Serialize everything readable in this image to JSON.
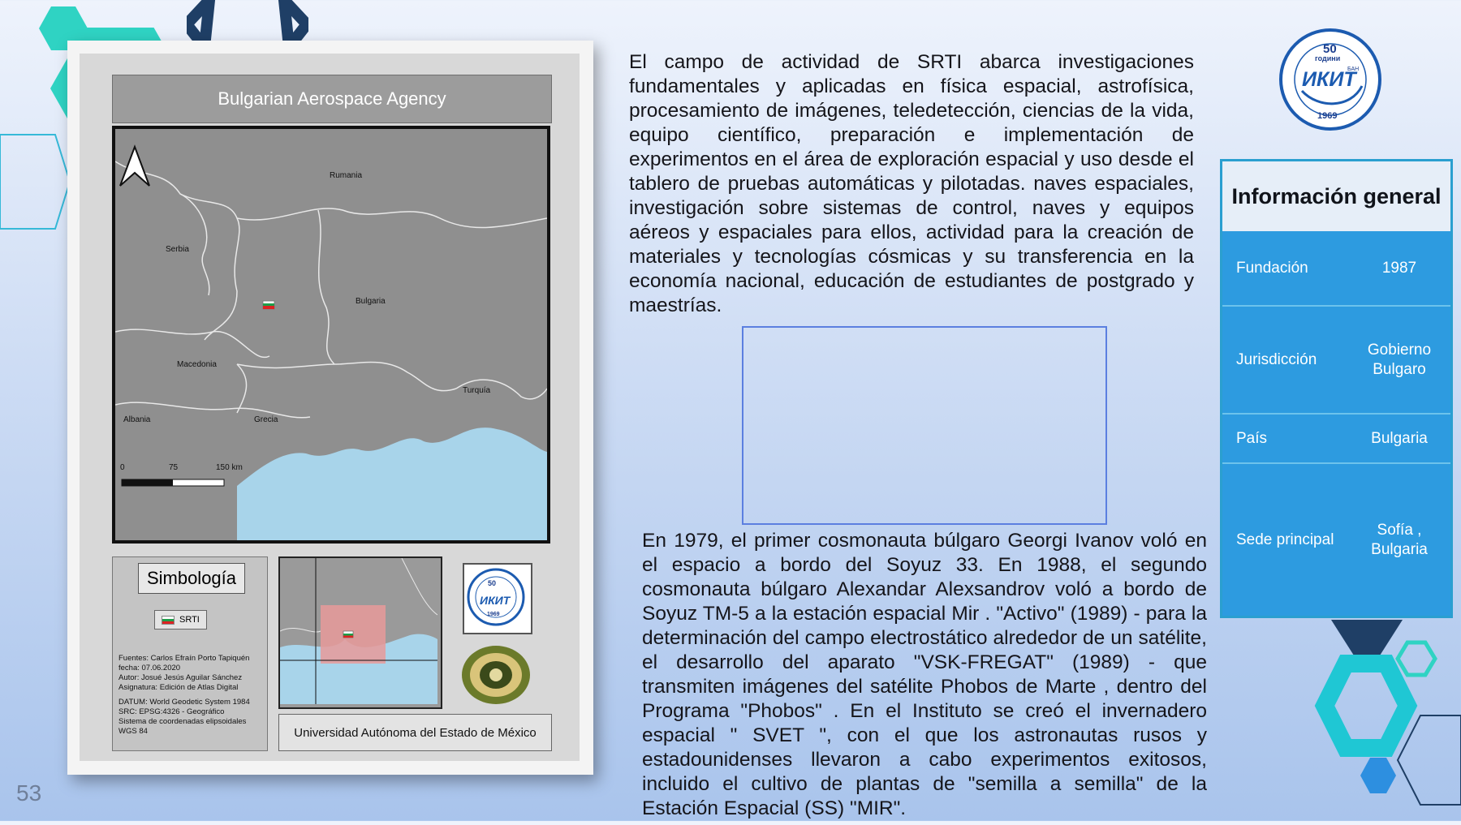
{
  "map": {
    "title": "Bulgarian Aerospace Agency",
    "labels": {
      "rumania": "Rumania",
      "serbia": "Serbia",
      "bulgaria": "Bulgaria",
      "macedonia": "Macedonia",
      "turquia": "Turquía",
      "albania": "Albania",
      "grecia": "Grecia"
    },
    "scale": {
      "zero": "0",
      "mid": "75",
      "end": "150 km"
    },
    "legend_title": "Simbología",
    "legend_item": "SRTI",
    "info_lines": [
      "Fuentes: Carlos Efraín Porto Tapiquén",
      "fecha: 07.06.2020",
      "Autor: Josué Jesús Aguilar Sánchez",
      "Asignatura: Edición de Atlas Digital",
      "",
      "DATUM: World Geodetic System 1984",
      "SRC: EPSG:4326 - Geográfico",
      "Sistema de coordenadas elipsoidales",
      "WGS 84"
    ],
    "institution": "Universidad Autónoma del Estado de México"
  },
  "logo": {
    "years": "50",
    "subtitle": "години",
    "acronym": "ИКИТ",
    "year": "1969",
    "ban": "БАН"
  },
  "paragraph1": "El campo de actividad de SRTI abarca investigaciones fundamentales y aplicadas en física espacial, astrofísica, procesamiento de imágenes, teledetección, ciencias de la vida, equipo científico, preparación e implementación de experimentos en el área de exploración espacial y uso desde el tablero de pruebas automáticas y pilotadas. naves espaciales, investigación sobre sistemas de control, naves y equipos aéreos y espaciales para ellos, actividad para la creación de materiales y tecnologías cósmicas y su transferencia en la economía nacional, educación de estudiantes de postgrado y maestrías.",
  "paragraph2": "En 1979, el primer cosmonauta búlgaro Georgi Ivanov voló en el espacio a bordo del Soyuz 33. En 1988, el segundo cosmonauta búlgaro Alexandar Alexsandrov voló a bordo de Soyuz TM-5 a la estación espacial Mir . \"Activo\" (1989) - para la determinación del campo electrostático alrededor de un satélite, el desarrollo del aparato \"VSK-FREGAT\" (1989) - que transmiten imágenes del satélite Phobos de Marte , dentro del Programa \"Phobos\" . En el Instituto se creó el invernadero espacial \" SVET \", con el que los astronautas rusos y estadounidenses llevaron a cabo experimentos exitosos, incluido el cultivo de plantas de \"semilla a semilla\" de la Estación Espacial (SS) \"MIR\".",
  "info_table": {
    "header": "Información general",
    "rows": [
      {
        "key": "Fundación",
        "value": "1987"
      },
      {
        "key": "Jurisdicción",
        "value": "Gobierno Bulgaro"
      },
      {
        "key": "País",
        "value": "Bulgaria"
      },
      {
        "key": "Sede principal",
        "value": "Sofía , Bulgaria"
      }
    ]
  },
  "page_number": "53",
  "colors": {
    "accent_teal": "#1fd6c4",
    "accent_navy": "#1f3f66",
    "table_blue": "#2d9be0"
  }
}
